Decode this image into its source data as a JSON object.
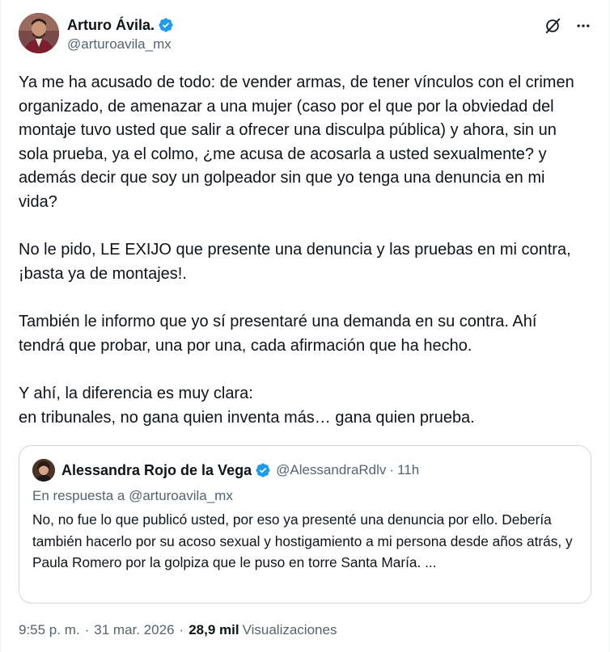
{
  "author": {
    "name": "Arturo Ávila.",
    "handle": "@arturoavila_mx"
  },
  "tweet": {
    "paragraphs": [
      "Ya me ha acusado de todo: de vender armas, de tener vínculos con el crimen organizado, de amenazar a una mujer (caso por el que por la obviedad del montaje tuvo usted que salir a ofrecer una disculpa pública) y ahora, sin un sola prueba, ya el colmo, ¿me acusa de acosarla a usted sexualmente? y además decir que soy un golpeador sin que yo tenga una denuncia en mi vida?",
      "No le pido, LE EXIJO que presente una denuncia y las pruebas en mi contra, ¡basta ya de montajes!.",
      "También le informo que yo sí presentaré  una demanda en su contra. Ahí tendrá que probar, una por una, cada afirmación que ha hecho.",
      "Y ahí, la diferencia es muy clara:\nen tribunales, no gana quien inventa más… gana quien prueba."
    ]
  },
  "quoted": {
    "name": "Alessandra Rojo de la Vega",
    "handle": "@AlessandraRdlv",
    "dot": "·",
    "time": "11h",
    "reply_prefix": "En respuesta a",
    "reply_handle": "@arturoavila_mx",
    "text": "No, no fue lo que publicó usted, por eso ya presenté una denuncia por ello. Debería también hacerlo por su acoso sexual y hostigamiento a mi persona desde años atrás, y Paula Romero por la golpiza  que le puso en torre Santa María. ..."
  },
  "meta": {
    "time": "9:55 p. m.",
    "sep1": "·",
    "date": "31 mar. 2026",
    "sep2": "·",
    "views_count": "28,9 mil",
    "views_label": "Visualizaciones"
  },
  "colors": {
    "verified": "#1d9bf0",
    "text": "#0f1419",
    "secondary": "#536471",
    "border": "#cfd9de"
  }
}
